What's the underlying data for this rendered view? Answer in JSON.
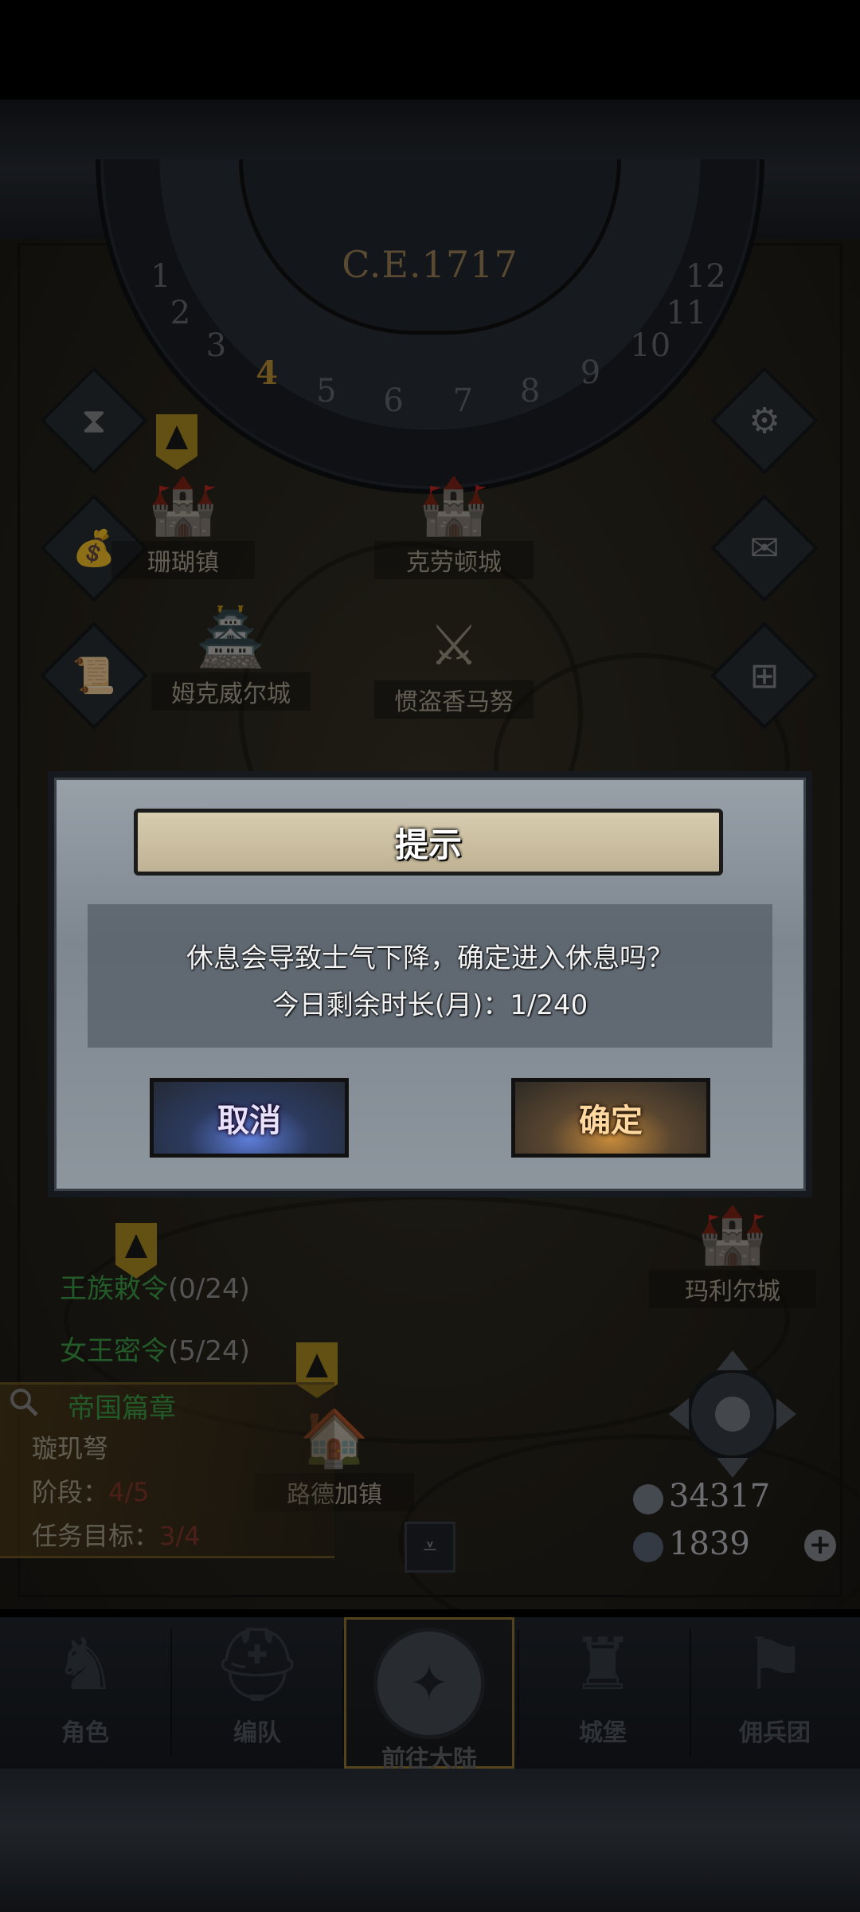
{
  "header": {
    "year": "C.E.1717"
  },
  "calendar": {
    "months": [
      "1",
      "2",
      "3",
      "4",
      "5",
      "6",
      "7",
      "8",
      "9",
      "10",
      "11",
      "12"
    ],
    "current_month": "4"
  },
  "map": {
    "towns": [
      {
        "id": "shanhu",
        "label": "珊瑚镇"
      },
      {
        "id": "kelaodun",
        "label": "克劳顿城"
      },
      {
        "id": "mukewei",
        "label": "姆克威尔城"
      },
      {
        "id": "guandao",
        "label": "惯盗香马努"
      },
      {
        "id": "mali",
        "label": "玛利尔城"
      },
      {
        "id": "lude",
        "label": "路德加镇"
      }
    ]
  },
  "side_buttons": {
    "left": [
      "hourglass-icon",
      "money-bag-icon",
      "scroll-icon"
    ],
    "right": [
      "gear-icon",
      "mail-icon",
      "window-icon"
    ]
  },
  "dialog": {
    "title": "提示",
    "message_line1": "休息会导致士气下降，确定进入休息吗？",
    "message_line2": "今日剩余时长(月)：1/240",
    "cancel_label": "取消",
    "confirm_label": "确定"
  },
  "quests": [
    {
      "name": "王族敕令",
      "count": "(0/24)"
    },
    {
      "name": "女王密令",
      "count": "(5/24)"
    }
  ],
  "chapter": {
    "title": "帝国篇章",
    "item": "璇玑弩",
    "stage_label": "阶段：",
    "stage_value": "4/5",
    "goal_label": "任务目标：",
    "goal_value": "3/4"
  },
  "resources": {
    "silver": "34317",
    "crystal": "1839"
  },
  "bottom_nav": {
    "items": [
      {
        "label": "角色",
        "icon": "knight-icon"
      },
      {
        "label": "编队",
        "icon": "helmet-icon"
      },
      {
        "label": "前往大陆",
        "icon": "compass-icon"
      },
      {
        "label": "城堡",
        "icon": "castle-icon"
      },
      {
        "label": "佣兵团",
        "icon": "banner-icon"
      }
    ],
    "active": "前往大陆"
  },
  "colors": {
    "quest_green": "#3fa64a",
    "accent_gold": "#c79a3a",
    "cancel_blue": "#5d7dd8",
    "confirm_orange": "#c68a3a"
  }
}
